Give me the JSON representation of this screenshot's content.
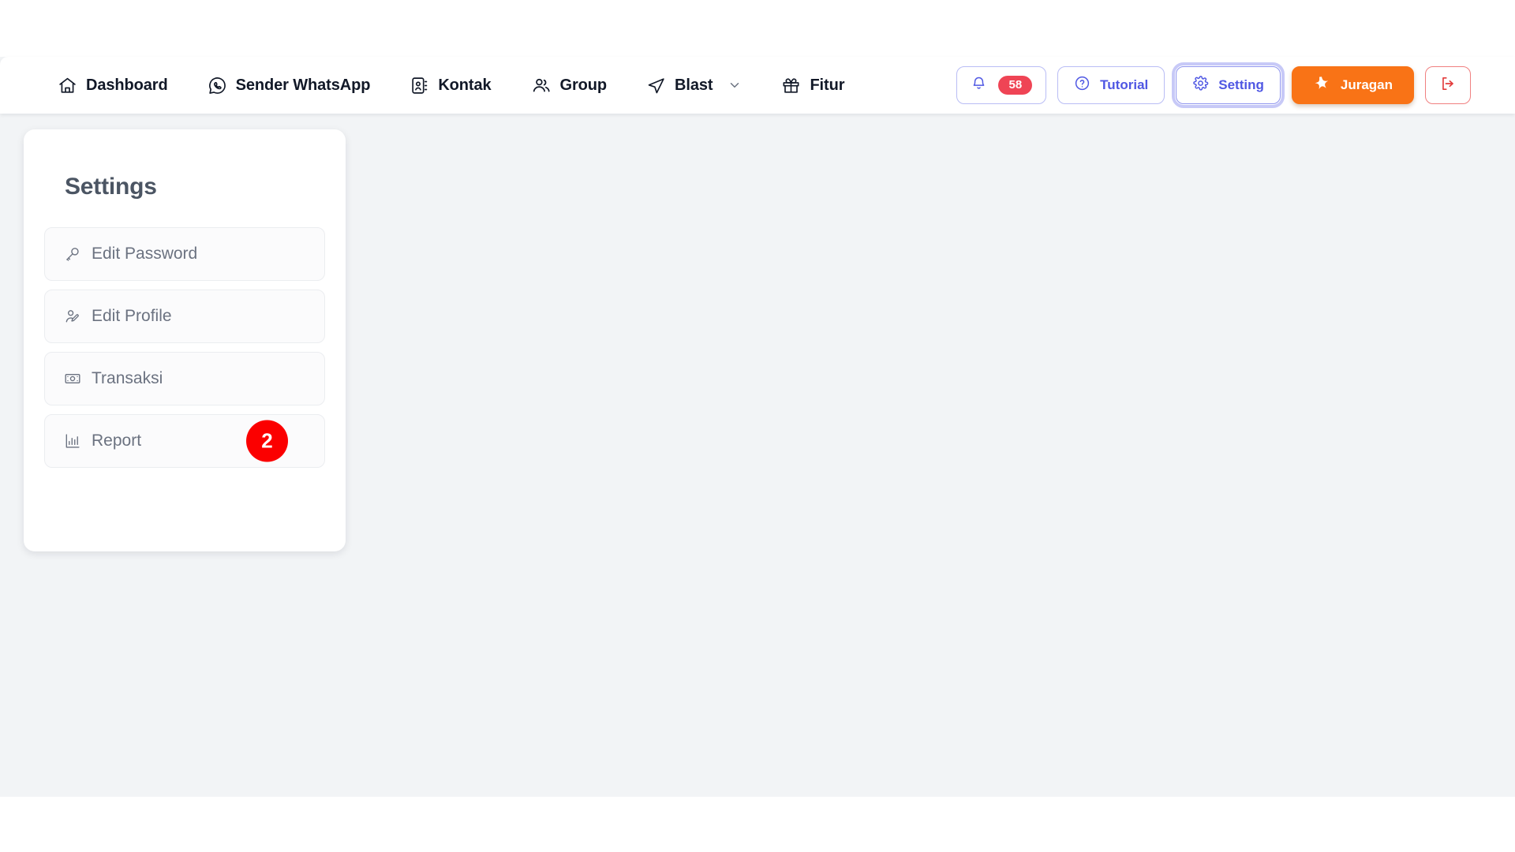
{
  "nav": {
    "items": [
      {
        "label": "Dashboard",
        "icon": "home-icon",
        "has_caret": false
      },
      {
        "label": "Sender WhatsApp",
        "icon": "whatsapp-icon",
        "has_caret": false
      },
      {
        "label": "Kontak",
        "icon": "contact-book-icon",
        "has_caret": false
      },
      {
        "label": "Group",
        "icon": "users-icon",
        "has_caret": false
      },
      {
        "label": "Blast",
        "icon": "send-icon",
        "has_caret": true
      },
      {
        "label": "Fitur",
        "icon": "gift-icon",
        "has_caret": false
      }
    ],
    "actions": {
      "notification_count": "58",
      "tutorial_label": "Tutorial",
      "setting_label": "Setting",
      "juragan_label": "Juragan"
    }
  },
  "settings": {
    "title": "Settings",
    "items": [
      {
        "label": "Edit Password",
        "icon": "key-icon"
      },
      {
        "label": "Edit Profile",
        "icon": "user-edit-icon"
      },
      {
        "label": "Transaksi",
        "icon": "banknote-icon"
      },
      {
        "label": "Report",
        "icon": "bar-chart-icon"
      }
    ],
    "step_marker": "2"
  },
  "colors": {
    "accent_purple": "#4f57e3",
    "accent_orange": "#f97316",
    "danger_red": "#e23b3b",
    "badge_red": "#ef4455",
    "marker_red": "#fb0000",
    "page_bg": "#f2f4f6"
  }
}
